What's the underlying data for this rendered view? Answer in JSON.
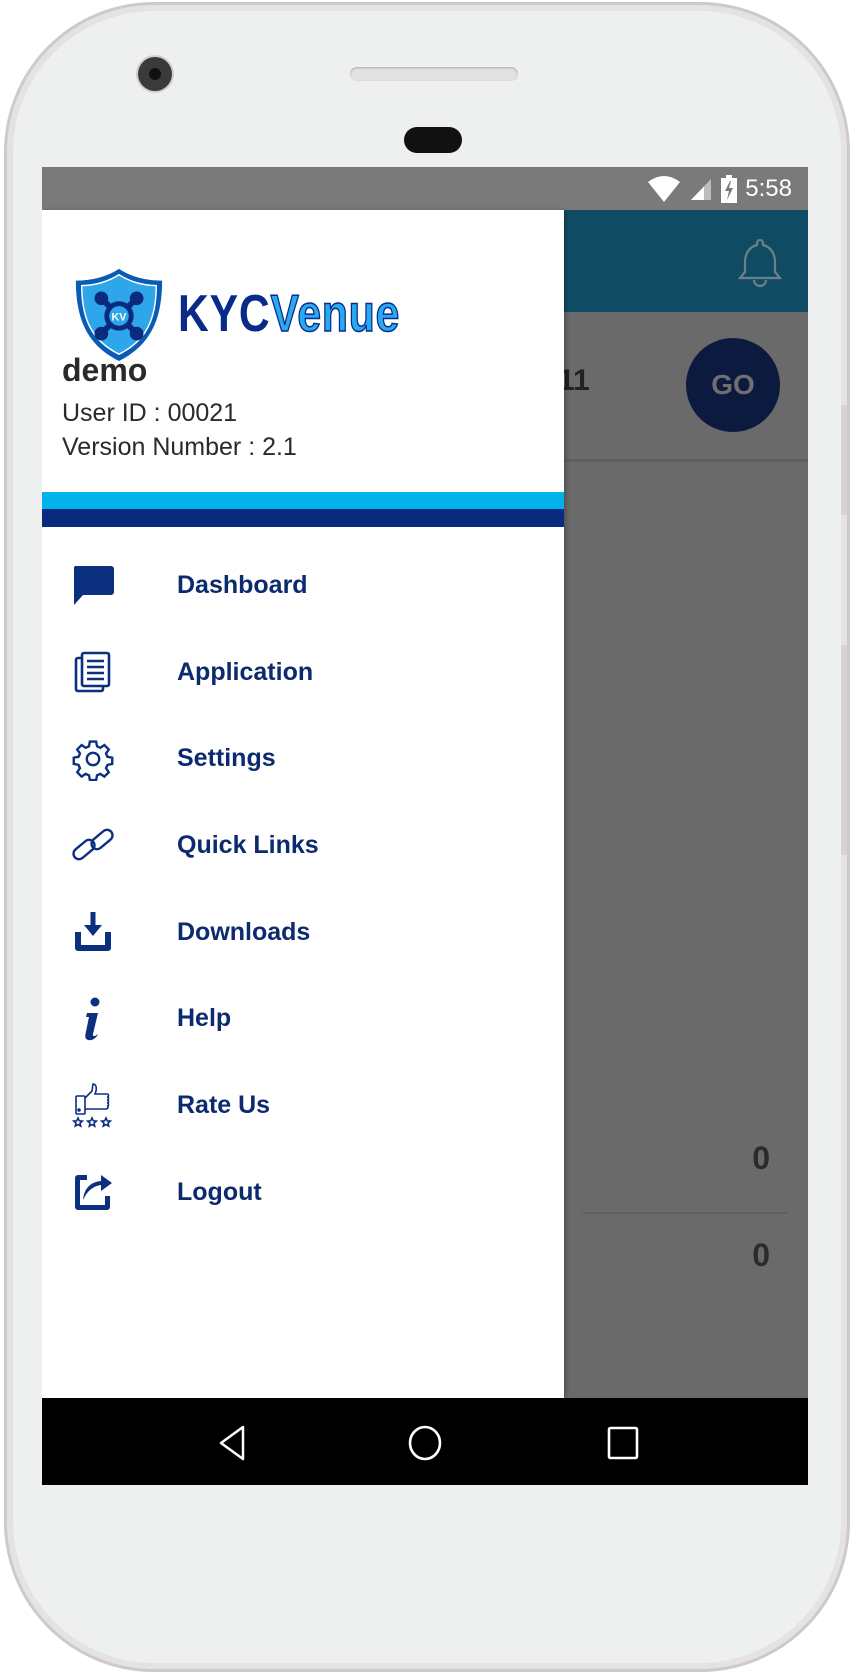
{
  "status_bar": {
    "time": "5:58",
    "icons": [
      "wifi-icon",
      "cell-signal-icon",
      "battery-charging-icon"
    ]
  },
  "app_bar": {
    "notification_icon": "bell-icon"
  },
  "background_screen": {
    "partial_value": "11",
    "go_button_label": "GO",
    "counts": [
      "0",
      "0"
    ]
  },
  "drawer": {
    "logo": {
      "brand_part1": "KYC",
      "brand_part2": "Venue",
      "badge_text": "KV"
    },
    "user": {
      "name": "demo",
      "user_id_label": "User ID : 00021",
      "version_label": "Version Number : 2.1"
    },
    "stripe_colors": {
      "top": "#00b3ec",
      "bottom": "#0a2a7e"
    },
    "menu_items": [
      {
        "label": "Dashboard",
        "icon": "chat-bubble-icon"
      },
      {
        "label": "Application",
        "icon": "document-icon"
      },
      {
        "label": "Settings",
        "icon": "gear-icon"
      },
      {
        "label": "Quick Links",
        "icon": "link-icon"
      },
      {
        "label": "Downloads",
        "icon": "download-icon"
      },
      {
        "label": "Help",
        "icon": "info-icon"
      },
      {
        "label": "Rate Us",
        "icon": "thumbs-up-stars-icon"
      },
      {
        "label": "Logout",
        "icon": "share-out-icon"
      }
    ]
  },
  "nav_bar": {
    "buttons": [
      "back-icon",
      "home-icon",
      "recents-icon"
    ]
  },
  "colors": {
    "accent_navy": "#0c2a6e",
    "app_bar": "#0f4c63",
    "scrim": "#6a6a6a"
  }
}
